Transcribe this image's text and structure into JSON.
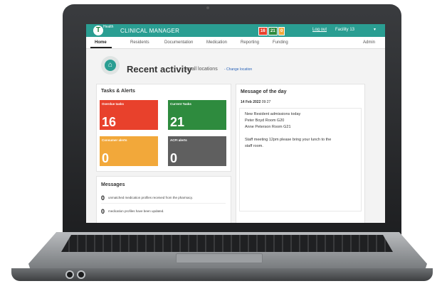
{
  "app": {
    "logo_letter": "T",
    "logo_sup": "Health",
    "title": "CLINICAL MANAGER",
    "badges": [
      {
        "value": "16",
        "color": "#e8412c"
      },
      {
        "value": "21",
        "color": "#2e8b3e"
      },
      {
        "value": "0",
        "color": "#f2a83a"
      }
    ],
    "logout_label": "Log out",
    "facility_label": "Facility 13",
    "menu_arrow": "▾"
  },
  "nav": {
    "items": [
      "Home",
      "Residents",
      "Documentation",
      "Medication",
      "Reporting",
      "Funding",
      "Admin"
    ]
  },
  "page": {
    "title": "Recent activity",
    "subtitle": "for all locations",
    "change_link": "- Change location",
    "home_icon": "⌂"
  },
  "tasks": {
    "title": "Tasks & Alerts",
    "tiles": [
      {
        "label": "Overdue tasks",
        "value": "16",
        "color": "#e8412c"
      },
      {
        "label": "Current Tasks",
        "value": "21",
        "color": "#2e8b3e"
      },
      {
        "label": "Consumer alerts",
        "value": "0",
        "color": "#f2a83a"
      },
      {
        "label": "ACFI alerts",
        "value": "0",
        "color": "#5f5f5f"
      }
    ]
  },
  "messages": {
    "title": "Messages",
    "rows": [
      {
        "count": "0",
        "text": "unmatched medication profiles received from the pharmacy."
      },
      {
        "count": "0",
        "text": "medication profiles have been updated."
      }
    ]
  },
  "motd": {
    "title": "Message of the day",
    "date": "14 Feb 2022",
    "time": "09:27",
    "lines": [
      "New Resident admissions today",
      "Peter Boyd Room G20",
      "Anne Peterson Room G21",
      "",
      "Staff meeting 12pm please bring your lunch to the",
      "staff room."
    ]
  }
}
